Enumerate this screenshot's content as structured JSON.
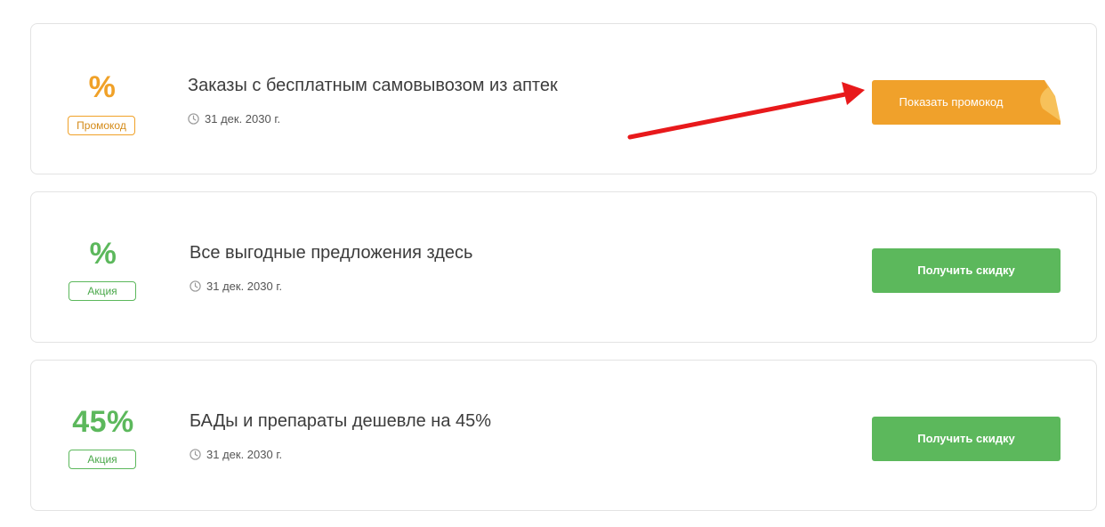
{
  "offers": [
    {
      "discount": "%",
      "tag": "Промокод",
      "title": "Заказы с бесплатным самовывозом из аптек",
      "date": "31 дек. 2030 г.",
      "button_label": "Показать промокод"
    },
    {
      "discount": "%",
      "tag": "Акция",
      "title": "Все выгодные предложения здесь",
      "date": "31 дек. 2030 г.",
      "button_label": "Получить скидку"
    },
    {
      "discount": "45%",
      "tag": "Акция",
      "title": "БАДы и препараты дешевле на 45%",
      "date": "31 дек. 2030 г.",
      "button_label": "Получить скидку"
    }
  ],
  "colors": {
    "promo_orange": "#f0a12b",
    "action_green": "#5cb85c",
    "annotation_red": "#e8191b"
  },
  "icons": {
    "date": "clock-icon",
    "annotation": "arrow-icon"
  }
}
